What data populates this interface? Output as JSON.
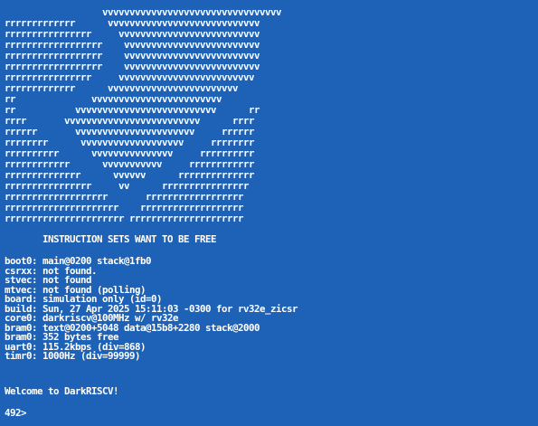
{
  "terminal": {
    "background_color": "#1e62b8",
    "text_color": "#ffffff",
    "banner": "                  vvvvvvvvvvvvvvvvvvvvvvvvvvvvvvvvv\nrrrrrrrrrrrrr      vvvvvvvvvvvvvvvvvvvvvvvvvvvv\nrrrrrrrrrrrrrrrr     vvvvvvvvvvvvvvvvvvvvvvvvvv\nrrrrrrrrrrrrrrrrrr    vvvvvvvvvvvvvvvvvvvvvvvvv\nrrrrrrrrrrrrrrrrrr    vvvvvvvvvvvvvvvvvvvvvvvvv\nrrrrrrrrrrrrrrrrrr    vvvvvvvvvvvvvvvvvvvvvvvvv\nrrrrrrrrrrrrrrrr     vvvvvvvvvvvvvvvvvvvvvvvvv\nrrrrrrrrrrrrr      vvvvvvvvvvvvvvvvvvvvvvvv\nrr              vvvvvvvvvvvvvvvvvvvvvvvv\nrr           vvvvvvvvvvvvvvvvvvvvvvvvvv      rr\nrrrr       vvvvvvvvvvvvvvvvvvvvvvvvv      rrrr\nrrrrrr       vvvvvvvvvvvvvvvvvvvvvv     rrrrrr\nrrrrrrrr      vvvvvvvvvvvvvvvvvvv     rrrrrrrr\nrrrrrrrrrr      vvvvvvvvvvvvvvv     rrrrrrrrrr\nrrrrrrrrrrrr      vvvvvvvvvvv     rrrrrrrrrrrr\nrrrrrrrrrrrrrr      vvvvvv      rrrrrrrrrrrrrr\nrrrrrrrrrrrrrrrr     vv      rrrrrrrrrrrrrrrr\nrrrrrrrrrrrrrrrrrrr       rrrrrrrrrrrrrrrrrr\nrrrrrrrrrrrrrrrrrrrrr    rrrrrrrrrrrrrrrrrrr\nrrrrrrrrrrrrrrrrrrrrrr rrrrrrrrrrrrrrrrrrrrr",
    "tagline": "INSTRUCTION SETS WANT TO BE FREE",
    "boot_info": "boot0: main@0200 stack@1fb0\ncsrxx: not found.\nstvec: not found\nmtvec: not found (polling)\nboard: simulation only (id=0)\nbuild: Sun, 27 Apr 2025 15:11:03 -0300 for rv32e_zicsr\ncore0: darkriscv@100MHz w/ rv32e\nbram0: text@0200+5048 data@15b8+2280 stack@2000\nbram0: 352 bytes free\nuart0: 115.2kbps (div=868)\ntimr0: 1000Hz (div=99999)",
    "welcome": "Welcome to DarkRISCV!",
    "prompt": "492>"
  }
}
